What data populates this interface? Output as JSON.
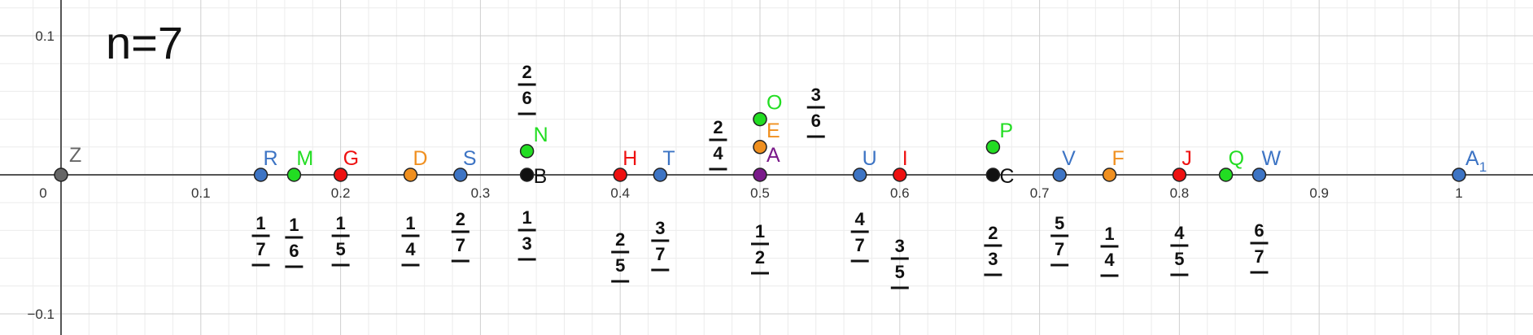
{
  "colors": {
    "blue": "#3d74c4",
    "green": "#22dd22",
    "red": "#ee1111",
    "orange": "#f09020",
    "black": "#111111",
    "purple": "#7a1a8a",
    "gray": "#666666"
  },
  "handwritten_title": "n=7",
  "axis": {
    "x_ticks": [
      "0",
      "0.1",
      "0.2",
      "0.3",
      "0.4",
      "0.5",
      "0.6",
      "0.7",
      "0.8",
      "0.9",
      "1"
    ],
    "y_ticks": [
      "0.1",
      "−0.1"
    ]
  },
  "points": [
    {
      "label": "Z",
      "value": 0,
      "color": "gray"
    },
    {
      "label": "R",
      "value": 0.1429,
      "color": "blue"
    },
    {
      "label": "M",
      "value": 0.1667,
      "color": "green"
    },
    {
      "label": "G",
      "value": 0.2,
      "color": "red"
    },
    {
      "label": "D",
      "value": 0.25,
      "color": "orange"
    },
    {
      "label": "S",
      "value": 0.2857,
      "color": "blue"
    },
    {
      "label": "B",
      "value": 0.3333,
      "color": "black"
    },
    {
      "label": "N",
      "value": 0.3333,
      "color": "green"
    },
    {
      "label": "H",
      "value": 0.4,
      "color": "red"
    },
    {
      "label": "T",
      "value": 0.4286,
      "color": "blue"
    },
    {
      "label": "A",
      "value": 0.5,
      "color": "purple"
    },
    {
      "label": "E",
      "value": 0.5,
      "color": "orange"
    },
    {
      "label": "O",
      "value": 0.5,
      "color": "green"
    },
    {
      "label": "U",
      "value": 0.5714,
      "color": "blue"
    },
    {
      "label": "I",
      "value": 0.6,
      "color": "red"
    },
    {
      "label": "C",
      "value": 0.6667,
      "color": "black"
    },
    {
      "label": "P",
      "value": 0.6667,
      "color": "green"
    },
    {
      "label": "V",
      "value": 0.7143,
      "color": "blue"
    },
    {
      "label": "F",
      "value": 0.75,
      "color": "orange"
    },
    {
      "label": "J",
      "value": 0.8,
      "color": "red"
    },
    {
      "label": "Q",
      "value": 0.8333,
      "color": "green"
    },
    {
      "label": "W",
      "value": 0.8571,
      "color": "blue"
    },
    {
      "label": "A",
      "subscript": "1",
      "value": 1,
      "color": "blue"
    }
  ],
  "fractions_below": [
    {
      "num": "1",
      "den": "7",
      "value": 0.1429
    },
    {
      "num": "1",
      "den": "6",
      "value": 0.1667
    },
    {
      "num": "1",
      "den": "5",
      "value": 0.2
    },
    {
      "num": "1",
      "den": "4",
      "value": 0.25
    },
    {
      "num": "2",
      "den": "7",
      "value": 0.2857
    },
    {
      "num": "1",
      "den": "3",
      "value": 0.3333
    },
    {
      "num": "2",
      "den": "5",
      "value": 0.4
    },
    {
      "num": "3",
      "den": "7",
      "value": 0.4286
    },
    {
      "num": "1",
      "den": "2",
      "value": 0.5
    },
    {
      "num": "4",
      "den": "7",
      "value": 0.5714
    },
    {
      "num": "3",
      "den": "5",
      "value": 0.6
    },
    {
      "num": "2",
      "den": "3",
      "value": 0.6667
    },
    {
      "num": "5",
      "den": "7",
      "value": 0.7143
    },
    {
      "num": "1",
      "den": "4",
      "value": 0.75
    },
    {
      "num": "4",
      "den": "5",
      "value": 0.8
    },
    {
      "num": "6",
      "den": "7",
      "value": 0.8571
    }
  ],
  "fractions_above": [
    {
      "num": "2",
      "den": "6",
      "value": 0.3333
    },
    {
      "num": "2",
      "den": "4",
      "value": 0.47
    },
    {
      "num": "3",
      "den": "6",
      "value": 0.54
    }
  ]
}
